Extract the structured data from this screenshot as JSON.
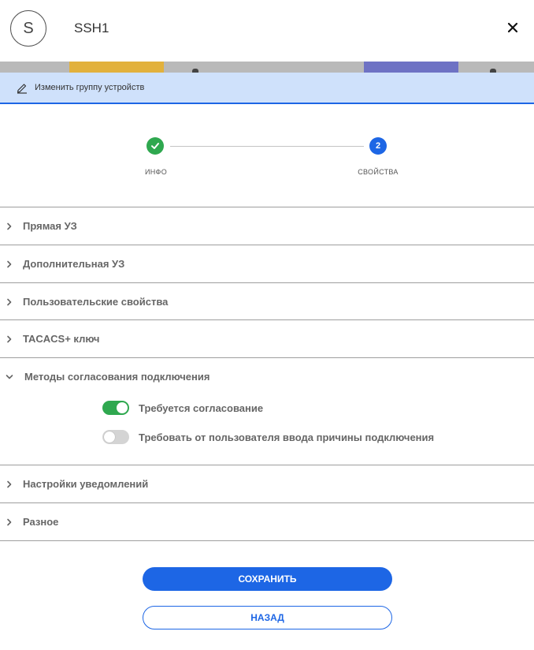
{
  "header": {
    "avatar_letter": "S",
    "title": "SSH1"
  },
  "action_bar": {
    "label": "Изменить группу устройств"
  },
  "stepper": {
    "steps": [
      {
        "label": "ИНФО",
        "number": "1",
        "status": "done"
      },
      {
        "label": "СВОЙСТВА",
        "number": "2",
        "status": "active"
      }
    ]
  },
  "sections": [
    {
      "label": "Прямая УЗ",
      "expanded": false
    },
    {
      "label": "Дополнительная УЗ",
      "expanded": false
    },
    {
      "label": "Пользовательские свойства",
      "expanded": false
    },
    {
      "label": "TACACS+ ключ",
      "expanded": false
    },
    {
      "label": "Методы согласования подключения",
      "expanded": true,
      "toggles": [
        {
          "label": "Требуется согласование",
          "on": true
        },
        {
          "label": "Требовать от пользователя ввода причины подключения",
          "on": false
        }
      ]
    },
    {
      "label": "Настройки уведомлений",
      "expanded": false
    },
    {
      "label": "Разное",
      "expanded": false
    }
  ],
  "buttons": {
    "save": "СОХРАНИТЬ",
    "back": "НАЗАД"
  },
  "colors": {
    "primary": "#1d66e5",
    "success": "#2fa84f",
    "bar_bg": "#cfe1fb",
    "toggle_off": "#d4d4d4"
  },
  "icons": {
    "close": "close-icon",
    "edit": "pencil-icon",
    "check": "check-icon",
    "chevron_right": "chevron-right-icon",
    "chevron_down": "chevron-down-icon"
  }
}
